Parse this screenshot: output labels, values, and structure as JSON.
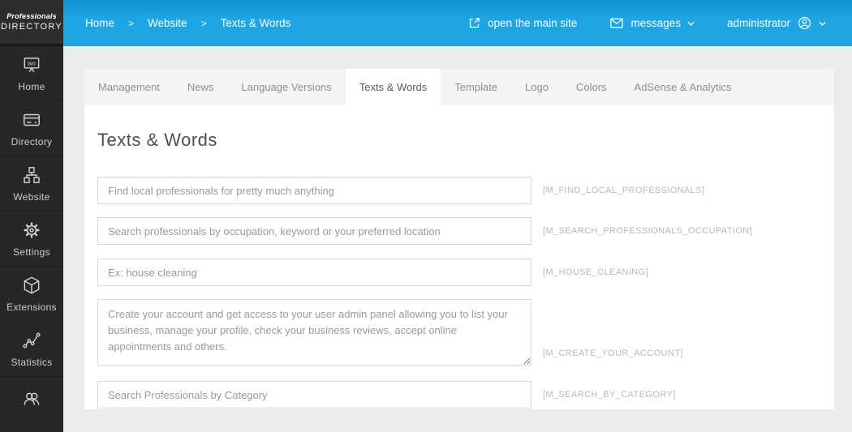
{
  "app": {
    "logo_line1": "Professionals",
    "logo_line2": "DIRECTORY"
  },
  "topbar": {
    "breadcrumb": {
      "items": [
        "Home",
        "Website",
        "Texts & Words"
      ],
      "separator": ">"
    },
    "open_main_site_label": "open the main site",
    "messages_label": "messages",
    "user_label": "administrator"
  },
  "sidebar": {
    "items": [
      {
        "label": "Home",
        "icon": "presentation-board-icon"
      },
      {
        "label": "Directory",
        "icon": "listing-card-icon"
      },
      {
        "label": "Website",
        "icon": "sitemap-icon"
      },
      {
        "label": "Settings",
        "icon": "gear-icon"
      },
      {
        "label": "Extensions",
        "icon": "cube-icon"
      },
      {
        "label": "Statistics",
        "icon": "line-chart-icon"
      },
      {
        "icon": "users-icon"
      }
    ]
  },
  "tabs": [
    "Management",
    "News",
    "Language Versions",
    "Texts & Words",
    "Template",
    "Logo",
    "Colors",
    "AdSense & Analytics"
  ],
  "active_tab": "Texts & Words",
  "page": {
    "title": "Texts & Words"
  },
  "fields": [
    {
      "type": "input",
      "value": "Find local professionals for pretty much anything",
      "key": "[M_FIND_LOCAL_PROFESSIONALS]"
    },
    {
      "type": "input",
      "value": "Search professionals by occupation, keyword or your preferred location",
      "key": "[M_SEARCH_PROFESSIONALS_OCCUPATION]"
    },
    {
      "type": "input",
      "value": "Ex: house cleaning",
      "key": "[M_HOUSE_CLEANING]"
    },
    {
      "type": "textarea",
      "value": "Create your account and get access to your user admin panel allowing you to list your business, manage your profile, check your business reviews, accept online appointments and others.",
      "key": "[M_CREATE_YOUR_ACCOUNT]"
    },
    {
      "type": "input",
      "value": "Search Professionals by Category",
      "key": "[M_SEARCH_BY_CATEGORY]"
    }
  ],
  "colors": {
    "topbar_blue": "#1da6e3",
    "sidebar_dark": "#272727",
    "page_bg": "#ececec",
    "tabbar_bg": "#f4f4f5",
    "accent_text": "#4f4f4f",
    "muted_key_label": "#b8b8b8"
  }
}
